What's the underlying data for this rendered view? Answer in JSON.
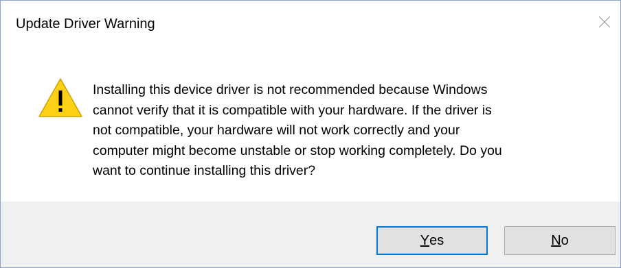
{
  "dialog": {
    "title": "Update Driver Warning",
    "close_icon": "close-icon",
    "warning_icon": "warning-triangle-icon",
    "message": "Installing this device driver is not recommended because Windows\ncannot verify that it is compatible with your hardware.  If the driver is\nnot compatible, your hardware will not work correctly and your\ncomputer might become unstable or stop working completely.  Do you\nwant to continue installing this driver?",
    "buttons": {
      "yes": {
        "accel": "Y",
        "rest": "es"
      },
      "no": {
        "accel": "N",
        "rest": "o"
      }
    },
    "colors": {
      "accent_border": "#0078d7",
      "warning_fill": "#fcd116",
      "footer_bg": "#f0f0f0"
    }
  }
}
